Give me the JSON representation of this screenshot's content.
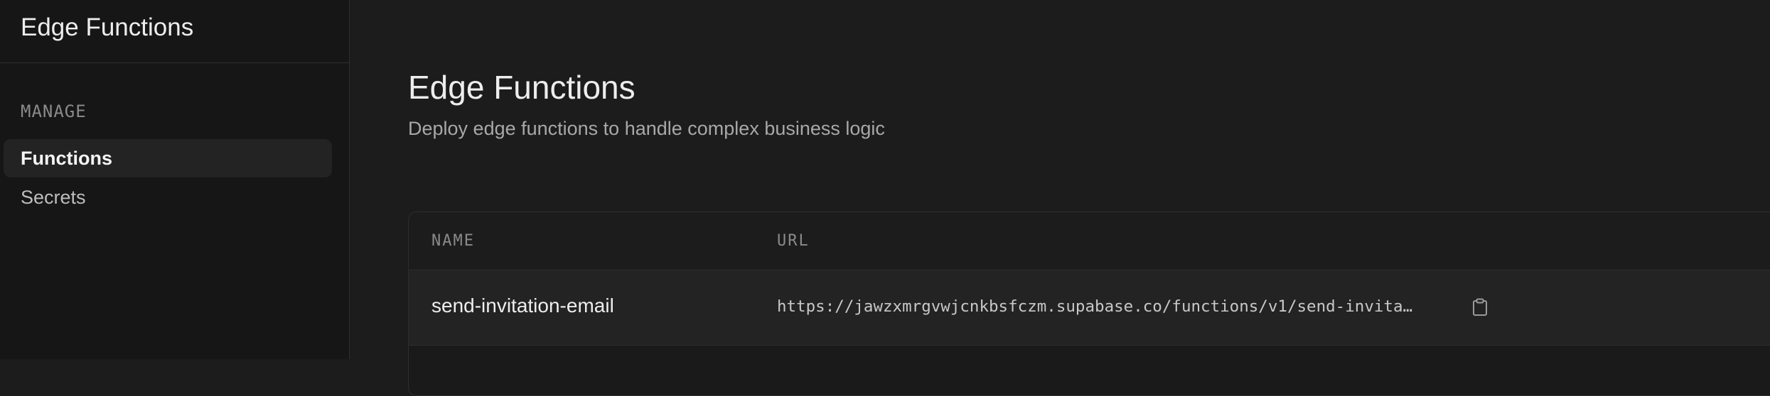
{
  "sidebar": {
    "title": "Edge Functions",
    "section_label": "MANAGE",
    "items": [
      {
        "label": "Functions",
        "active": true
      },
      {
        "label": "Secrets",
        "active": false
      }
    ]
  },
  "main": {
    "title": "Edge Functions",
    "subtitle": "Deploy edge functions to handle complex business logic",
    "table": {
      "columns": [
        "NAME",
        "URL"
      ],
      "rows": [
        {
          "name": "send-invitation-email",
          "url": "https://jawzxmrgvwjcnkbsfczm.supabase.co/functions/v1/send-invita…"
        }
      ]
    }
  },
  "icons": {
    "copy": "clipboard-icon"
  },
  "colors": {
    "background": "#1c1c1c",
    "sidebar_background": "#161616",
    "active_item_background": "#232323",
    "border": "#2e2e2e",
    "text_primary": "#ededed",
    "text_muted": "#8a8a8a"
  }
}
